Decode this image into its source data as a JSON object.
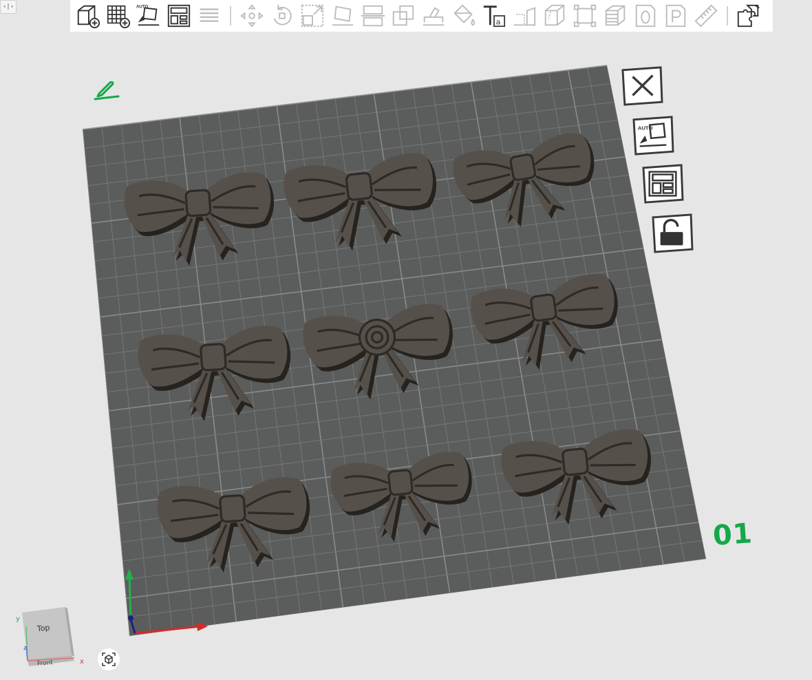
{
  "window": {
    "collapse_glyph": "‹|›"
  },
  "toolbar": {
    "tools": [
      {
        "name": "add-object",
        "icon": "cube-plus-icon",
        "enabled": true
      },
      {
        "name": "add-plate",
        "icon": "grid-plus-icon",
        "enabled": true
      },
      {
        "name": "auto-orient",
        "icon": "auto-orient-icon",
        "enabled": true,
        "label": "AUTO"
      },
      {
        "name": "arrange",
        "icon": "arrange-icon",
        "enabled": true
      },
      {
        "name": "layers",
        "icon": "layers-icon",
        "enabled": false
      },
      {
        "name": "move",
        "icon": "move-icon",
        "enabled": false
      },
      {
        "name": "rotate",
        "icon": "rotate-icon",
        "enabled": false
      },
      {
        "name": "scale",
        "icon": "scale-icon",
        "enabled": false
      },
      {
        "name": "lay-on-face",
        "icon": "lay-on-face-icon",
        "enabled": false
      },
      {
        "name": "cut",
        "icon": "cut-icon",
        "enabled": false
      },
      {
        "name": "boolean",
        "icon": "boolean-icon",
        "enabled": false
      },
      {
        "name": "support-paint",
        "icon": "support-paint-icon",
        "enabled": false
      },
      {
        "name": "color-paint",
        "icon": "color-paint-icon",
        "enabled": false
      },
      {
        "name": "text",
        "icon": "text-icon",
        "enabled": true
      },
      {
        "name": "emboss",
        "icon": "emboss-icon",
        "enabled": false
      },
      {
        "name": "seam",
        "icon": "seam-icon",
        "enabled": false
      },
      {
        "name": "fit-box",
        "icon": "fit-box-icon",
        "enabled": false
      },
      {
        "name": "layer-stack",
        "icon": "layer-stack-icon",
        "enabled": false
      },
      {
        "name": "zero-height",
        "icon": "zero-icon",
        "enabled": false
      },
      {
        "name": "pause",
        "icon": "pause-p-icon",
        "enabled": false
      },
      {
        "name": "measure",
        "icon": "ruler-icon",
        "enabled": false
      },
      {
        "name": "assembly",
        "icon": "puzzle-icon",
        "enabled": true
      }
    ]
  },
  "side_panel": {
    "buttons": [
      {
        "name": "close-plate",
        "icon": "close-x-icon"
      },
      {
        "name": "auto-orient-plate",
        "icon": "auto-orient-icon",
        "label": "AUTO"
      },
      {
        "name": "arrange-plate",
        "icon": "arrange-icon"
      },
      {
        "name": "lock-plate",
        "icon": "unlock-icon"
      }
    ]
  },
  "plate": {
    "label": "01",
    "label_color": "#14a84a",
    "surface_color": "#5b5c5c",
    "model_color": "#56504a"
  },
  "view_cube": {
    "top_face": "Top",
    "front_face": "Front",
    "axis_x": "x",
    "axis_y": "y",
    "axis_z": "z"
  },
  "colors": {
    "background": "#e6e6e6",
    "axis_x": "#d42a2a",
    "axis_y": "#22b14c",
    "axis_z": "#1a237e"
  }
}
